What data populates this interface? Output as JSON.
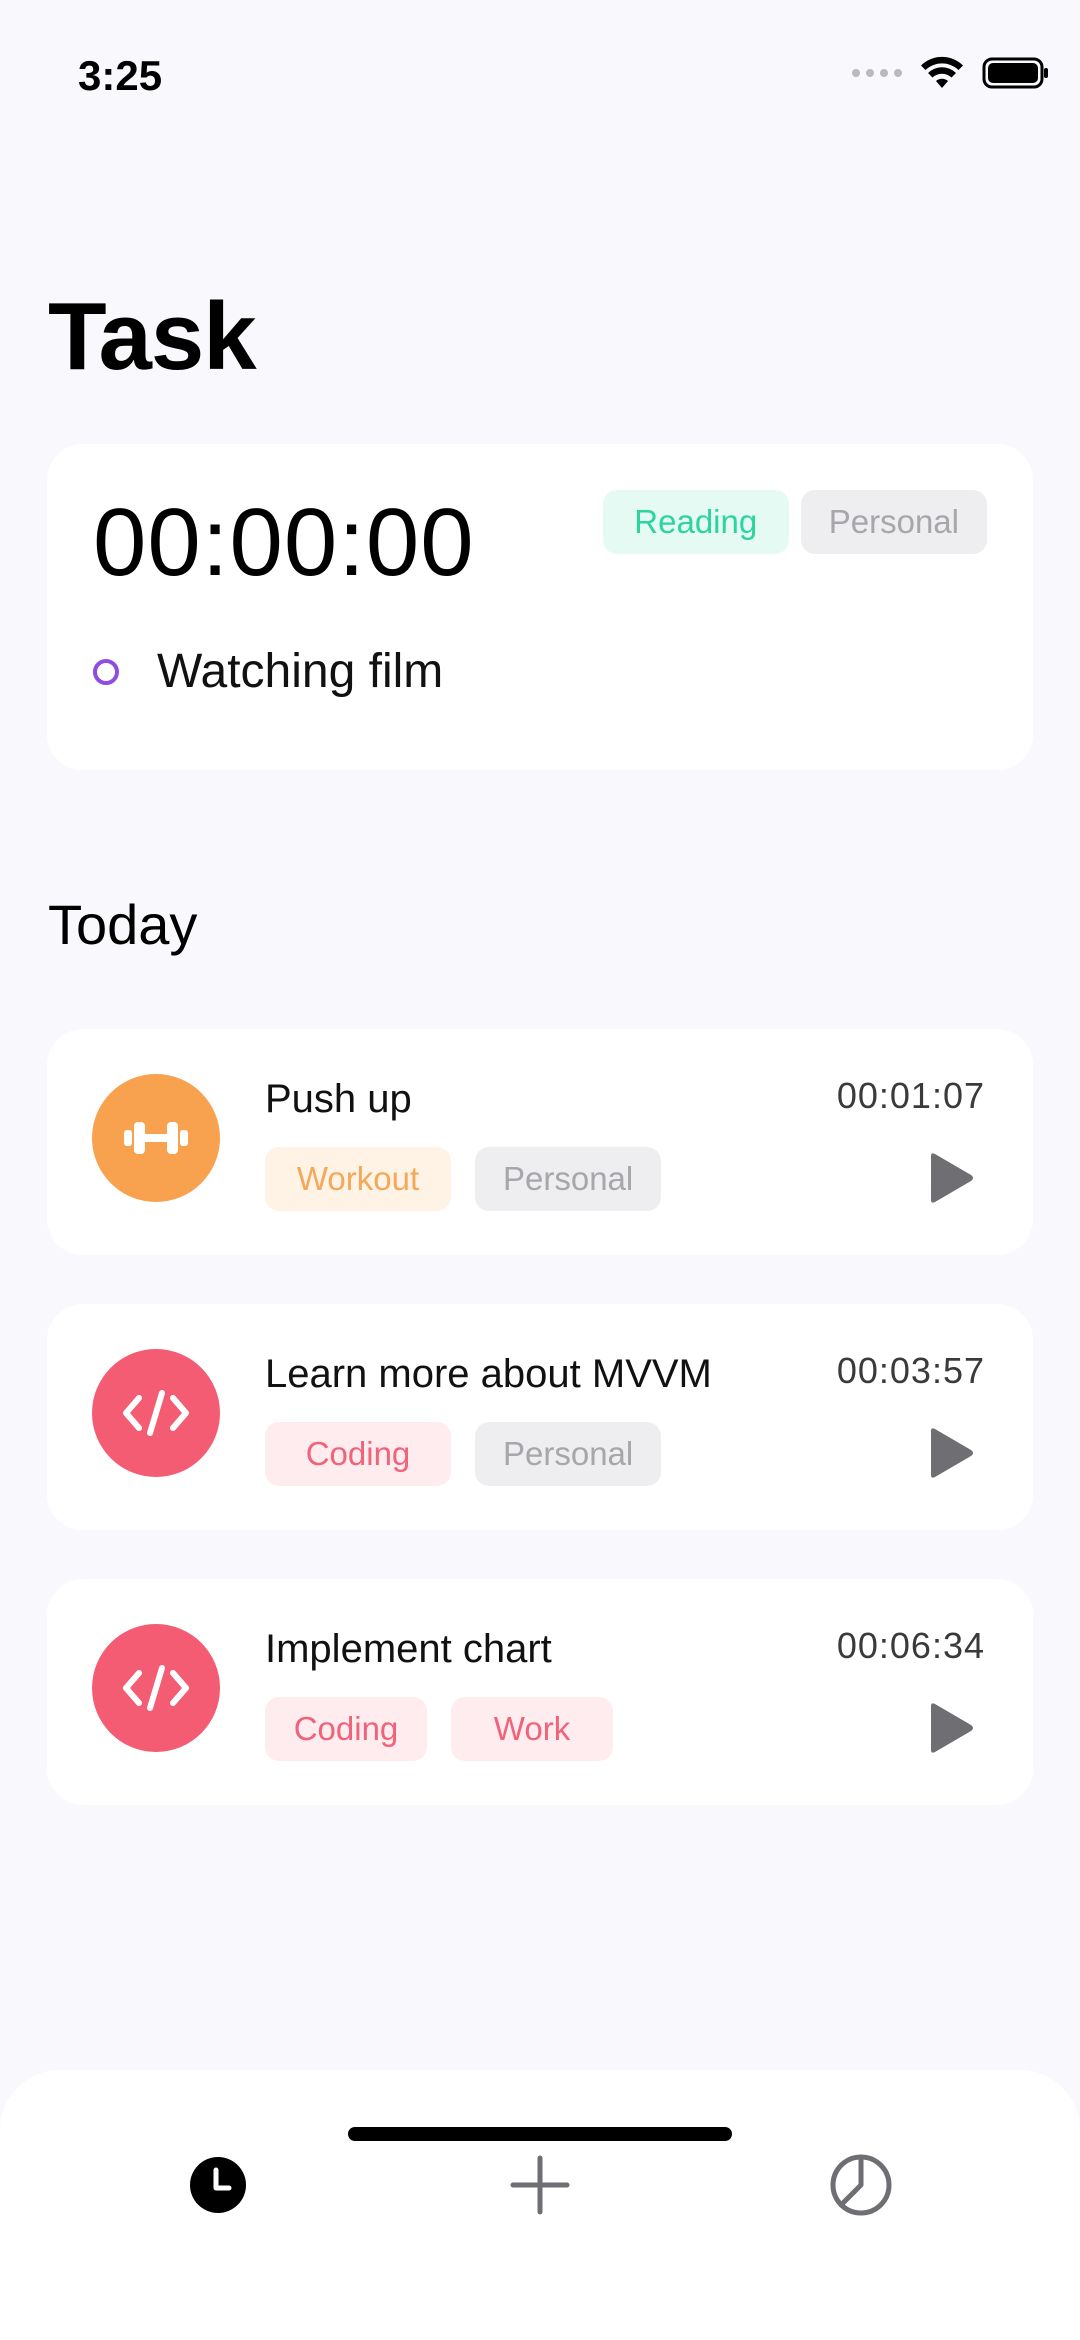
{
  "status_bar": {
    "time": "3:25"
  },
  "page_title": "Task",
  "timer": {
    "value": "00:00:00",
    "tags": [
      "Reading",
      "Personal"
    ],
    "current_task": "Watching film"
  },
  "section_title": "Today",
  "tasks": [
    {
      "title": "Push up",
      "duration": "00:01:07",
      "icon": "dumbbell-icon",
      "tags": [
        "Workout",
        "Personal"
      ]
    },
    {
      "title": "Learn more about MVVM",
      "duration": "00:03:57",
      "icon": "code-icon",
      "tags": [
        "Coding",
        "Personal"
      ]
    },
    {
      "title": "Implement chart",
      "duration": "00:06:34",
      "icon": "code-icon",
      "tags": [
        "Coding",
        "Work"
      ]
    }
  ],
  "tab_bar": {
    "tabs": [
      {
        "icon": "clock-icon",
        "active": true
      },
      {
        "icon": "plus-icon",
        "active": false
      },
      {
        "icon": "pie-chart-icon",
        "active": false
      }
    ]
  },
  "colors": {
    "accent_green": "#2DD4A0",
    "workout_orange": "#F8A24F",
    "coding_red": "#F35C72",
    "radio_purple": "#8E4CE0"
  }
}
